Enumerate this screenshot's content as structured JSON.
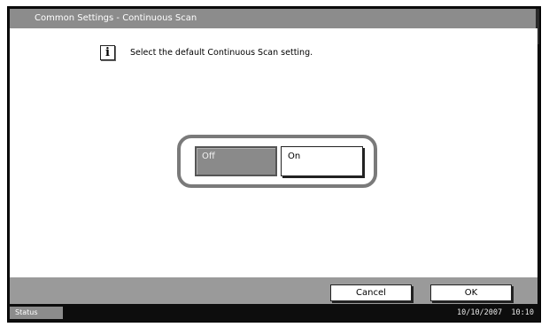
{
  "window": {
    "title": "Common Settings - Continuous Scan"
  },
  "info": {
    "icon": "info-icon",
    "glyph": "i",
    "message": "Select the default Continuous Scan setting."
  },
  "options": {
    "off_label": "Off",
    "on_label": "On",
    "selected": "Off"
  },
  "footer": {
    "cancel_label": "Cancel",
    "ok_label": "OK"
  },
  "status": {
    "tab_label": "Status",
    "date": "10/10/2007",
    "time": "10:10"
  }
}
